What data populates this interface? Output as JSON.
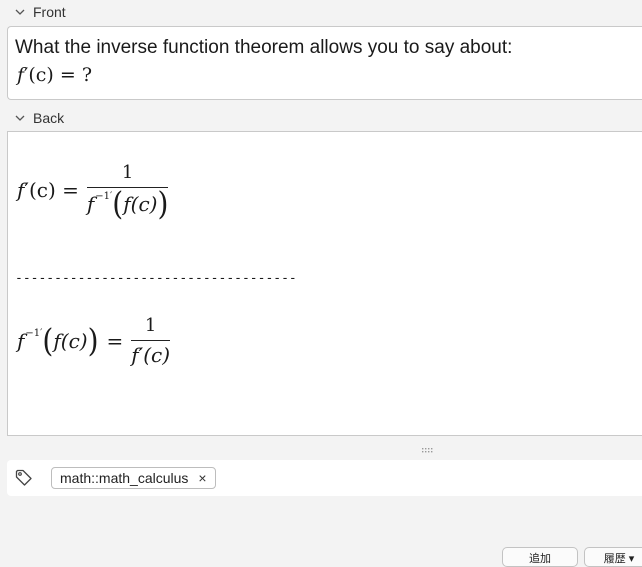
{
  "fields": {
    "front": {
      "label": "Front",
      "question_text": "What the inverse function theorem allows you to say about:",
      "formula_f": "f",
      "formula_prime": "′",
      "formula_arg": "(c)",
      "formula_eq": " = ?"
    },
    "back": {
      "label": "Back",
      "formula1": {
        "lhs_f": "f",
        "lhs_rest": "′(c) =",
        "numerator": "1",
        "den_f": "f",
        "den_sup": "−1′",
        "den_inner": "f(c)"
      },
      "separator": "------------------------------------",
      "formula2": {
        "lhs_f": "f",
        "lhs_sup": "−1′",
        "lhs_inner": "f(c)",
        "eq": "=",
        "numerator": "1",
        "den": "f′(c)"
      }
    }
  },
  "tags": {
    "items": [
      {
        "label": "math::math_calculus",
        "remove_symbol": "×"
      }
    ]
  },
  "buttons": {
    "add_label": "追加",
    "history_label": "履歴 ▾"
  },
  "icons": {
    "collapse": "chevron-down-icon",
    "tag": "tag-icon",
    "splitter": "drag-handle-icon"
  }
}
